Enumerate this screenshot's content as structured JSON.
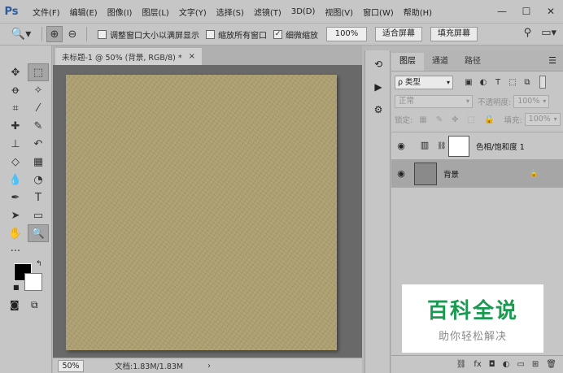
{
  "app": {
    "logo": "Ps"
  },
  "menu": [
    "文件(F)",
    "编辑(E)",
    "图像(I)",
    "图层(L)",
    "文字(Y)",
    "选择(S)",
    "滤镜(T)",
    "3D(D)",
    "视图(V)",
    "窗口(W)",
    "帮助(H)"
  ],
  "window_controls": {
    "minimize": "—",
    "maximize": "☐",
    "close": "✕"
  },
  "options": {
    "resize_windows_label": "调整窗口大小以满屏显示",
    "resize_windows_checked": false,
    "zoom_all_label": "缩放所有窗口",
    "zoom_all_checked": false,
    "scrubby_zoom_label": "细微缩放",
    "scrubby_zoom_checked": true,
    "zoom_value": "100%",
    "fit_screen_label": "适合屏幕",
    "fill_screen_label": "填充屏幕"
  },
  "document": {
    "tab_title": "未标题-1 @ 50% (背景, RGB/8) *",
    "close_glyph": "×",
    "canvas_color": "#ab9e6e"
  },
  "status": {
    "zoom": "50%",
    "doc_info": "文档:1.83M/1.83M",
    "arrow": "›"
  },
  "layers_panel": {
    "tabs": [
      "图层",
      "通道",
      "路径"
    ],
    "filter_kind": "ρ 类型",
    "blend_mode": "正常",
    "opacity_label": "不透明度:",
    "opacity_value": "100%",
    "lock_label": "锁定:",
    "fill_label": "填充:",
    "fill_value": "100%",
    "layers": [
      {
        "name": "色相/饱和度 1",
        "type": "adjustment",
        "visible": true,
        "selected": false
      },
      {
        "name": "背景",
        "type": "background",
        "visible": true,
        "selected": true,
        "locked": true
      }
    ]
  },
  "watermark": {
    "title": "百科全说",
    "subtitle": "助你轻松解决"
  }
}
